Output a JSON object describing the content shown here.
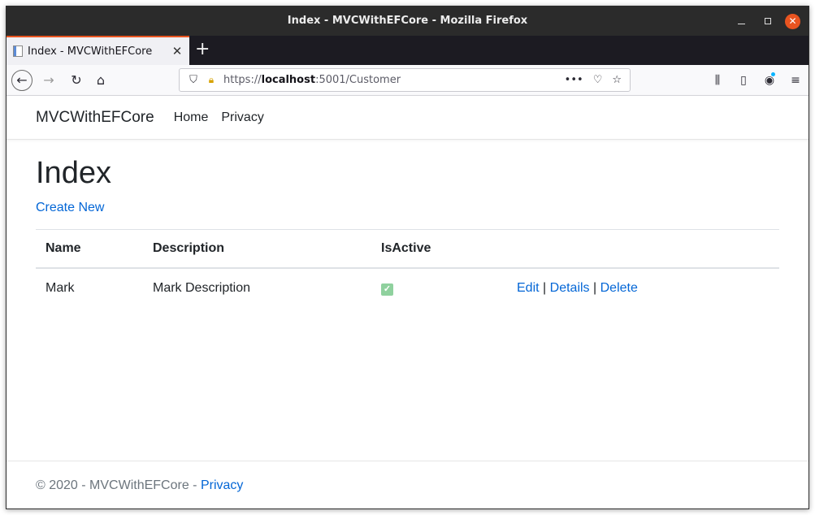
{
  "window": {
    "title": "Index - MVCWithEFCore - Mozilla Firefox",
    "minimize_glyph": "",
    "close_glyph": "✕"
  },
  "tabs": {
    "active_title": "Index - MVCWithEFCore",
    "close_glyph": "✕",
    "new_tab_glyph": "+"
  },
  "toolbar": {
    "back_glyph": "←",
    "forward_glyph": "→",
    "reload_glyph": "↻",
    "home_glyph": "⌂",
    "url_scheme": "https://",
    "url_host": "localhost",
    "url_rest": ":5001/Customer",
    "page_actions_glyph": "•••",
    "pocket_glyph": "♡",
    "bookmark_glyph": "☆",
    "library_glyph": "⫼",
    "sidebar_glyph": "▯",
    "account_glyph": "◉",
    "menu_glyph": "≡"
  },
  "site": {
    "brand": "MVCWithEFCore",
    "nav": [
      "Home",
      "Privacy"
    ]
  },
  "main": {
    "heading": "Index",
    "create_link": "Create New",
    "table": {
      "headers": [
        "Name",
        "Description",
        "IsActive",
        ""
      ],
      "rows": [
        {
          "name": "Mark",
          "description": "Mark Description",
          "is_active": true,
          "checkbox_glyph": "✓",
          "actions": [
            "Edit",
            "Details",
            "Delete"
          ],
          "separator": "|"
        }
      ]
    }
  },
  "footer": {
    "text": "© 2020 - MVCWithEFCore - ",
    "privacy_link": "Privacy"
  },
  "colors": {
    "accent": "#e95420",
    "link": "#0366d6",
    "checkbox": "#8fd19e",
    "titlebar": "#2b2b2b"
  }
}
